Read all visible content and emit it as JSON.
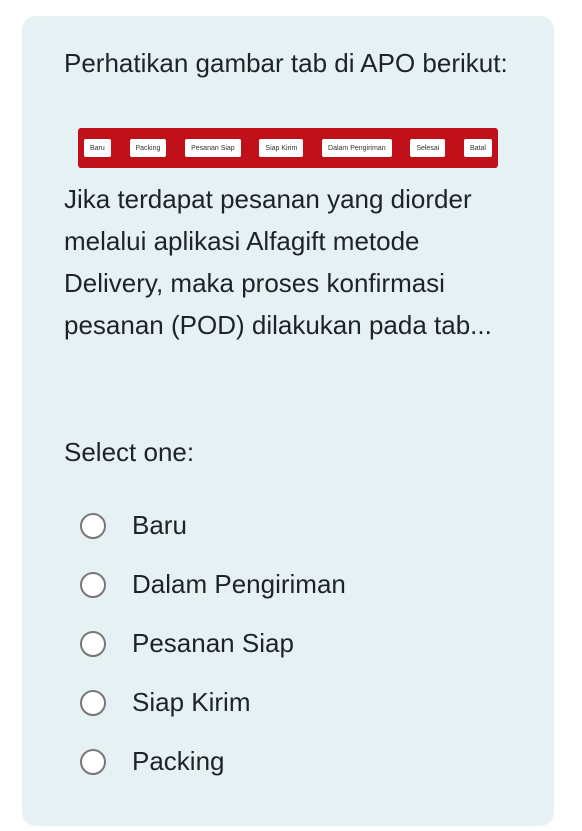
{
  "question": {
    "intro": "Perhatikan gambar tab di APO berikut:",
    "body": "Jika terdapat pesanan yang diorder melalui aplikasi Alfagift metode Delivery, maka proses konfirmasi pesanan (POD) dilakukan pada tab...",
    "tab_image": {
      "background_color": "#c0101a",
      "tabs": [
        "Baru",
        "Packing",
        "Pesanan Siap",
        "Siap Kirim",
        "Dalam Pengiriman",
        "Selesai",
        "Batal"
      ]
    }
  },
  "answer_area": {
    "prompt": "Select one:",
    "options": [
      "Baru",
      "Dalam Pengiriman",
      "Pesanan Siap",
      "Siap Kirim",
      "Packing"
    ],
    "selected": null
  },
  "colors": {
    "card_background": "#e6f1f3",
    "text": "#1f2328",
    "radio_border": "#777777"
  }
}
